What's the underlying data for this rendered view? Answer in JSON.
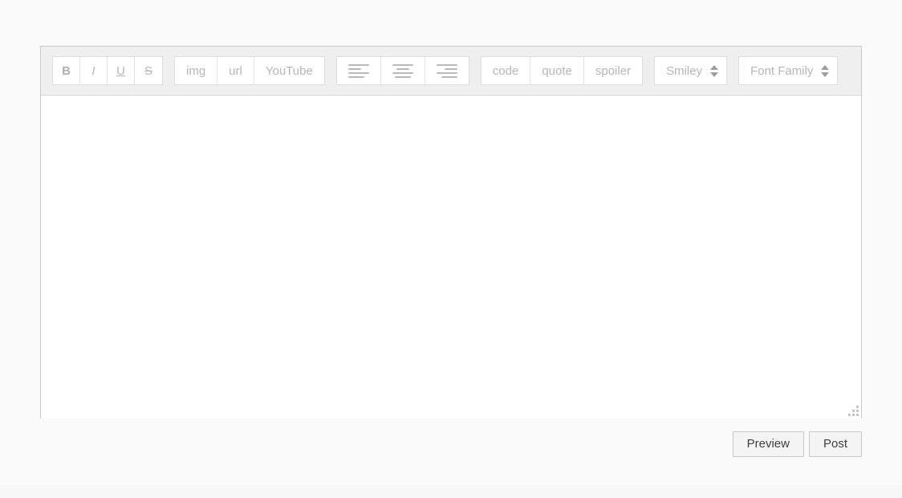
{
  "editor": {
    "toolbar": {
      "groups": [
        {
          "name": "text-format",
          "buttons": [
            {
              "label": "B",
              "name": "bold-button",
              "style": "bold"
            },
            {
              "label": "I",
              "name": "italic-button",
              "style": "italic"
            },
            {
              "label": "U",
              "name": "underline-button",
              "style": "under"
            },
            {
              "label": "S",
              "name": "strikethrough-button",
              "style": "strike"
            }
          ]
        },
        {
          "name": "media",
          "buttons": [
            {
              "label": "img",
              "name": "image-button",
              "style": "wide"
            },
            {
              "label": "url",
              "name": "url-button",
              "style": "wide"
            },
            {
              "label": "YouTube",
              "name": "youtube-button",
              "style": "wide"
            }
          ]
        },
        {
          "name": "alignment",
          "buttons": [
            {
              "label": "",
              "name": "align-left-button",
              "icon": "align-left-icon"
            },
            {
              "label": "",
              "name": "align-center-button",
              "icon": "align-center-icon"
            },
            {
              "label": "",
              "name": "align-right-button",
              "icon": "align-right-icon"
            }
          ]
        },
        {
          "name": "blocks",
          "buttons": [
            {
              "label": "code",
              "name": "code-button",
              "style": "wide"
            },
            {
              "label": "quote",
              "name": "quote-button",
              "style": "wide"
            },
            {
              "label": "spoiler",
              "name": "spoiler-button",
              "style": "wide"
            }
          ]
        }
      ],
      "selects": [
        {
          "label": "Smiley",
          "name": "smiley-select"
        },
        {
          "label": "Font Family",
          "name": "font-family-select"
        }
      ]
    },
    "compose": {
      "value": "",
      "placeholder": ""
    }
  },
  "actions": {
    "preview_label": "Preview",
    "post_label": "Post"
  },
  "colors": {
    "page_background": "#fafafa",
    "toolbar_background": "#efefef",
    "button_text": "#b6b6b6",
    "action_text": "#3d3d3d",
    "border": "#c9c9c9"
  }
}
